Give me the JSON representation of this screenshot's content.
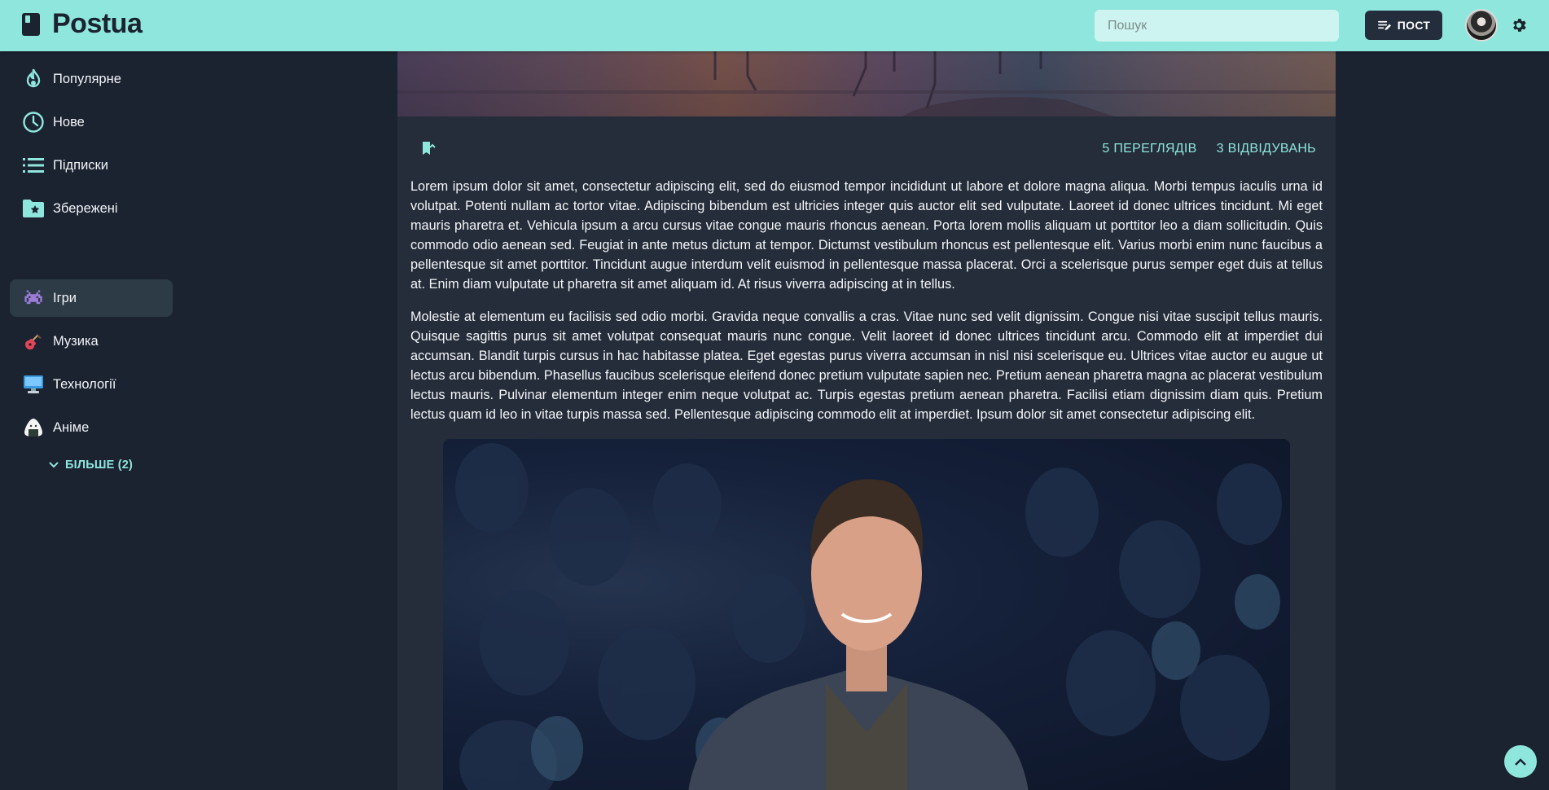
{
  "header": {
    "brand": "Postua",
    "search_placeholder": "Пошук",
    "post_button": "ПОСТ"
  },
  "sidebar": {
    "items": [
      {
        "label": "Популярне",
        "icon": "flame-icon"
      },
      {
        "label": "Нове",
        "icon": "clock-icon"
      },
      {
        "label": "Підписки",
        "icon": "list-icon"
      },
      {
        "label": "Збережені",
        "icon": "star-folder-icon"
      }
    ],
    "categories": [
      {
        "label": "Ігри",
        "icon": "space-invader-icon",
        "active": true
      },
      {
        "label": "Музика",
        "icon": "guitar-icon"
      },
      {
        "label": "Технології",
        "icon": "computer-icon"
      },
      {
        "label": "Аніме",
        "icon": "onigiri-icon"
      }
    ],
    "more_label": "БІЛЬШЕ (2)"
  },
  "post": {
    "views": "5 ПЕРЕГЛЯДІВ",
    "visits": "3 ВІДВІДУВАНЬ",
    "paragraphs": [
      "Lorem ipsum dolor sit amet, consectetur adipiscing elit, sed do eiusmod tempor incididunt ut labore et dolore magna aliqua. Morbi tempus iaculis urna id volutpat. Potenti nullam ac tortor vitae. Adipiscing bibendum est ultricies integer quis auctor elit sed vulputate. Laoreet id donec ultrices tincidunt. Mi eget mauris pharetra et. Vehicula ipsum a arcu cursus vitae congue mauris rhoncus aenean. Porta lorem mollis aliquam ut porttitor leo a diam sollicitudin. Quis commodo odio aenean sed. Feugiat in ante metus dictum at tempor. Dictumst vestibulum rhoncus est pellentesque elit. Varius morbi enim nunc faucibus a pellentesque sit amet porttitor. Tincidunt augue interdum velit euismod in pellentesque massa placerat. Orci a scelerisque purus semper eget duis at tellus at. Enim diam vulputate ut pharetra sit amet aliquam id. At risus viverra adipiscing at in tellus.",
      "Molestie at elementum eu facilisis sed odio morbi. Gravida neque convallis a cras. Vitae nunc sed velit dignissim. Congue nisi vitae suscipit tellus mauris. Quisque sagittis purus sit amet volutpat consequat mauris nunc congue. Velit laoreet id donec ultrices tincidunt arcu. Commodo elit at imperdiet dui accumsan. Blandit turpis cursus in hac habitasse platea. Eget egestas purus viverra accumsan in nisl nisi scelerisque eu. Ultrices vitae auctor eu augue ut lectus arcu bibendum. Phasellus faucibus scelerisque eleifend donec pretium vulputate sapien nec. Pretium aenean pharetra magna ac placerat vestibulum lectus mauris. Pulvinar elementum integer enim neque volutpat ac. Turpis egestas pretium aenean pharetra. Facilisi etiam dignissim diam quis. Pretium lectus quam id leo in vitae turpis massa sed. Pellentesque adipiscing commodo elit at imperdiet. Ipsum dolor sit amet consectetur adipiscing elit."
    ]
  },
  "colors": {
    "accent": "#8ee6dc",
    "background": "#1b2230",
    "card": "#252c3a",
    "active_item": "#2d3b46"
  }
}
